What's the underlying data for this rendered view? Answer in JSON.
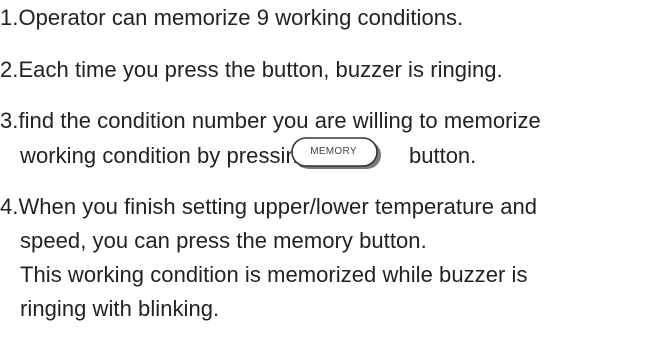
{
  "instructions": {
    "item1": "1.Operator can memorize 9 working conditions.",
    "item2": "2.Each time you press the button, buzzer is ringing.",
    "item3_line1": "3.find the condition number you are willing to memorize",
    "item3_line2_before": "working condition by pressing",
    "memory_button_label": "MEMORY",
    "item3_line2_after": "button.",
    "item4_line1": "4.When you finish setting upper/lower temperature and",
    "item4_line2": "speed, you can press the memory button.",
    "item4_line3": "This working condition is memorized while buzzer is",
    "item4_line4": "ringing with blinking."
  }
}
